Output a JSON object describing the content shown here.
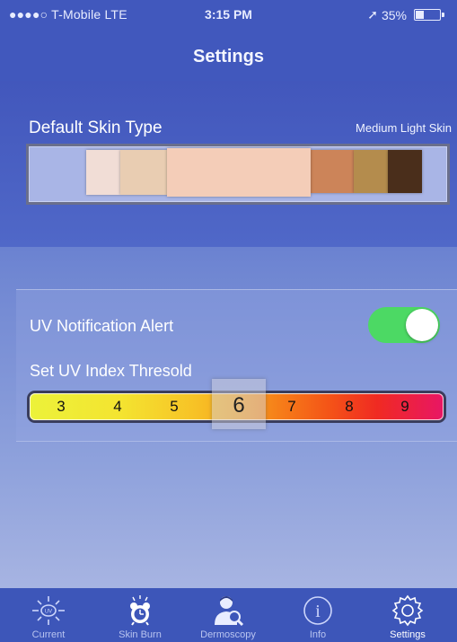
{
  "status_bar": {
    "carrier": "●●●●○ T-Mobile  LTE",
    "time": "3:15 PM",
    "battery": "35%",
    "battery_level": 0.35
  },
  "nav": {
    "title": "Settings"
  },
  "skin": {
    "title": "Default Skin Type",
    "selected": "Medium Light Skin",
    "swatches": [
      {
        "name": "very-light",
        "color": "#f1ddd6"
      },
      {
        "name": "light",
        "color": "#e9cdb2"
      },
      {
        "name": "medium-light",
        "color": "#f4cdb8",
        "selected": true
      },
      {
        "name": "medium",
        "color": "#cc8459"
      },
      {
        "name": "dark",
        "color": "#b48c4d"
      },
      {
        "name": "very-dark",
        "color": "#4a2e1b"
      }
    ]
  },
  "uv": {
    "notification_label": "UV Notification Alert",
    "notification_on": true,
    "threshold_label": "Set UV Index Thresold",
    "scale": [
      "3",
      "4",
      "5",
      "6",
      "7",
      "8",
      "9"
    ],
    "selected": "6"
  },
  "tabs": [
    {
      "label": "Current",
      "icon": "sun-uv-icon"
    },
    {
      "label": "Skin Burn",
      "icon": "alarm-clock-icon"
    },
    {
      "label": "Dermoscopy",
      "icon": "doctor-magnifier-icon"
    },
    {
      "label": "Info",
      "icon": "info-icon"
    },
    {
      "label": "Settings",
      "icon": "gear-icon",
      "active": true
    }
  ],
  "colors": {
    "nav_bg": "#4158bd",
    "toggle_on": "#4cd964",
    "tab_active": "#ffffff",
    "tab_inactive": "#b9c4f0"
  }
}
